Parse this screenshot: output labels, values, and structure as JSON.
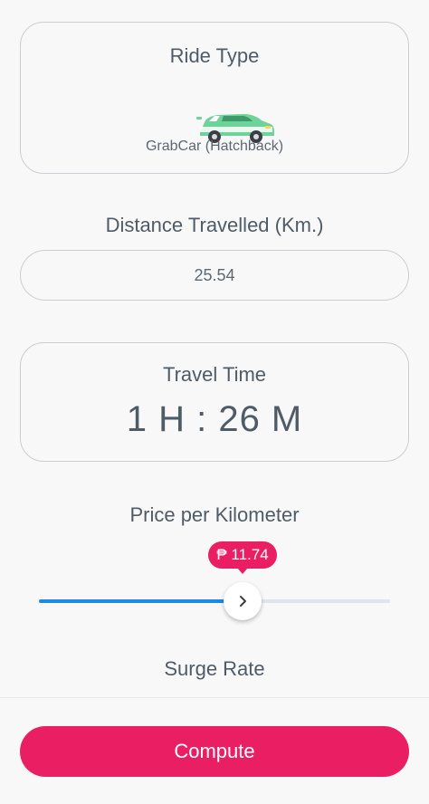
{
  "ride": {
    "title": "Ride Type",
    "car_icon": "car-icon",
    "subtitle": "GrabCar (Hatchback)"
  },
  "distance": {
    "label": "Distance Travelled (Km.)",
    "value": "25.54"
  },
  "travel_time": {
    "title": "Travel Time",
    "value": "1 H : 26 M"
  },
  "price": {
    "label": "Price per Kilometer",
    "badge": "₱ 11.74",
    "slider_fraction": 0.58,
    "thumb_icon": "chevron-right-icon"
  },
  "surge": {
    "label": "Surge Rate"
  },
  "actions": {
    "compute_label": "Compute"
  },
  "colors": {
    "accent": "#ea1f63",
    "slider_fill": "#1e88e5",
    "car_green": "#6dd39a"
  }
}
